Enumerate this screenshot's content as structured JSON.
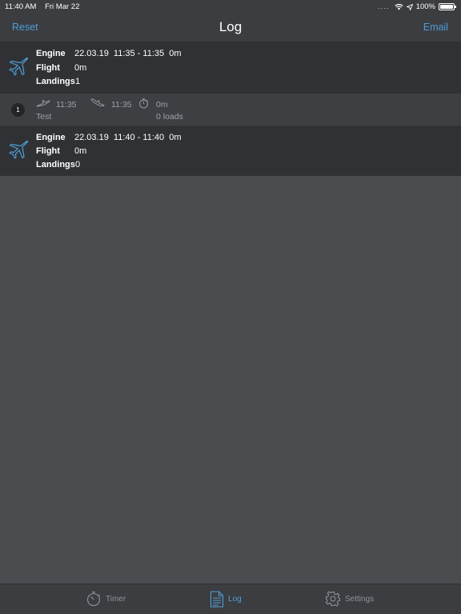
{
  "status_bar": {
    "time": "11:40 AM",
    "date": "Fri Mar 22",
    "signal": "....",
    "battery": "100%"
  },
  "nav": {
    "left_label": "Reset",
    "title": "Log",
    "right_label": "Email"
  },
  "entries": [
    {
      "engine_label": "Engine",
      "engine_value": "22.03.19  11:35 - 11:35  0m",
      "flight_label": "Flight",
      "flight_value": "0m",
      "landings_label": "Landings",
      "landings_value": "1"
    },
    {
      "engine_label": "Engine",
      "engine_value": "22.03.19  11:40 - 11:40  0m",
      "flight_label": "Flight",
      "flight_value": "0m",
      "landings_label": "Landings",
      "landings_value": "0"
    }
  ],
  "leg": {
    "number": "1",
    "takeoff_time": "11:35",
    "landing_time": "11:35",
    "duration": "0m",
    "note": "Test",
    "loads": "0 loads"
  },
  "tabs": [
    {
      "label": "Timer",
      "icon": "stopwatch-icon",
      "active": false
    },
    {
      "label": "Log",
      "icon": "document-icon",
      "active": true
    },
    {
      "label": "Settings",
      "icon": "gear-icon",
      "active": false
    }
  ],
  "colors": {
    "accent": "#4d9fd8",
    "background": "#4a4d50",
    "entry_background": "#2f3134",
    "bar_background": "#3b3d40"
  }
}
